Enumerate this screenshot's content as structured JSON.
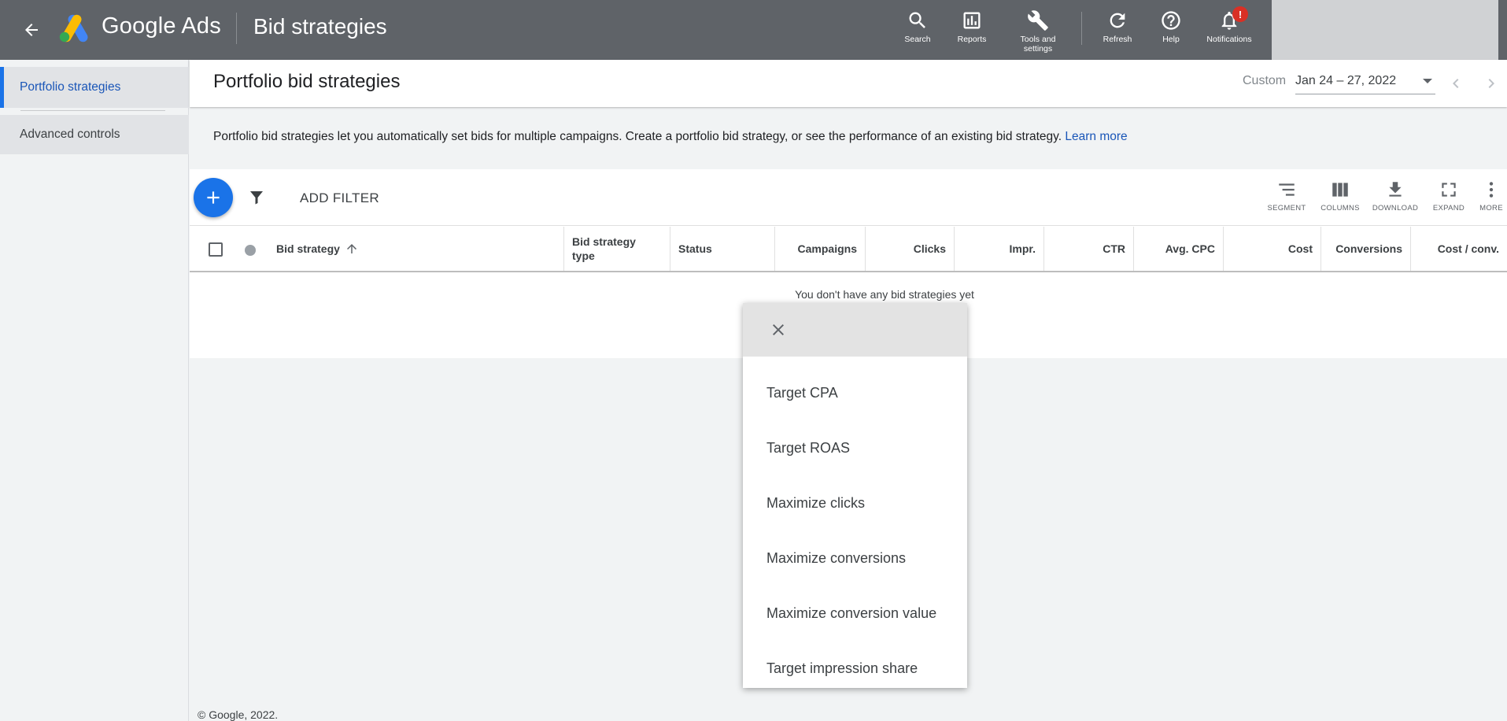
{
  "topbar": {
    "product_name": "Google Ads",
    "page_name": "Bid strategies",
    "tools": [
      {
        "label": "Search",
        "icon": "search-icon"
      },
      {
        "label": "Reports",
        "icon": "reports-icon"
      },
      {
        "label": "Tools and settings",
        "icon": "wrench-icon"
      },
      {
        "label": "Refresh",
        "icon": "refresh-icon"
      },
      {
        "label": "Help",
        "icon": "help-icon"
      },
      {
        "label": "Notifications",
        "icon": "bell-icon"
      }
    ],
    "notification_badge": "!"
  },
  "sidebar": {
    "items": [
      {
        "label": "Portfolio strategies",
        "active": true
      },
      {
        "label": "Advanced controls",
        "active": false
      }
    ]
  },
  "header": {
    "title": "Portfolio bid strategies",
    "date_label": "Custom",
    "date_range": "Jan 24 – 27, 2022"
  },
  "description": {
    "text": "Portfolio bid strategies let you automatically set bids for multiple campaigns. Create a portfolio bid strategy, or see the performance of an existing bid strategy.",
    "link": "Learn more"
  },
  "toolbar": {
    "add_filter": "ADD FILTER",
    "tools": [
      {
        "label": "SEGMENT",
        "icon": "segment-icon"
      },
      {
        "label": "COLUMNS",
        "icon": "columns-icon"
      },
      {
        "label": "DOWNLOAD",
        "icon": "download-icon"
      },
      {
        "label": "EXPAND",
        "icon": "expand-icon"
      },
      {
        "label": "MORE",
        "icon": "more-vert-icon"
      }
    ]
  },
  "table": {
    "columns": [
      "Bid strategy",
      "Bid strategy type",
      "Status",
      "Campaigns",
      "Clicks",
      "Impr.",
      "CTR",
      "Avg. CPC",
      "Cost",
      "Conversions",
      "Cost / conv."
    ],
    "empty_message": "You don't have any bid strategies yet"
  },
  "menu": {
    "items": [
      "Target CPA",
      "Target ROAS",
      "Maximize clicks",
      "Maximize conversions",
      "Maximize conversion value",
      "Target impression share"
    ]
  },
  "footer": {
    "copyright": "© Google, 2022."
  },
  "colors": {
    "topbar": "#5f6368",
    "accent": "#1a73e8",
    "link": "#1a56b8",
    "badge": "#d93025"
  }
}
